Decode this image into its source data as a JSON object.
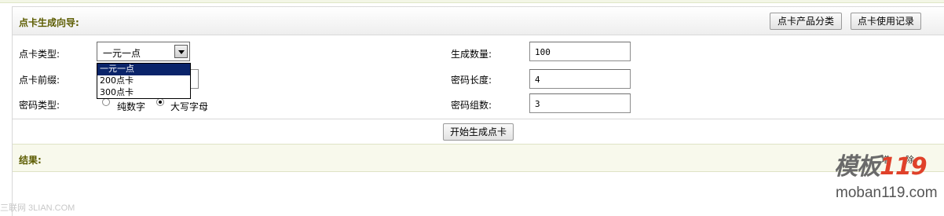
{
  "header": {
    "title": "点卡生成向导:",
    "buttons": {
      "category": "点卡产品分类",
      "records": "点卡使用记录"
    }
  },
  "form": {
    "card_type": {
      "label": "点卡类型:",
      "selected": "一元一点",
      "options": [
        "一元一点",
        "200点卡",
        "300点卡"
      ]
    },
    "card_prefix": {
      "label": "点卡前缀:",
      "value": ""
    },
    "password_type": {
      "label": "密码类型:",
      "options": [
        {
          "label": "纯数字",
          "checked": false
        },
        {
          "label": "大写字母",
          "checked": true
        }
      ]
    },
    "quantity": {
      "label": "生成数量:",
      "value": "100"
    },
    "password_length": {
      "label": "密码长度:",
      "value": "4"
    },
    "password_groups": {
      "label": "密码组数:",
      "value": "3"
    }
  },
  "generate_button": "开始生成点卡",
  "result": {
    "title": "结果:",
    "cut_text_1": "增",
    "cut_text_2": "除"
  },
  "watermarks": {
    "left": "三联网 3LIAN.COM",
    "logo_text": "模板",
    "logo_num": "119",
    "logo_domain": "moban119.com"
  },
  "colors": {
    "title_color": "#5c5c00",
    "dropdown_selected": "#0a246a",
    "logo_accent": "#e0412a"
  }
}
